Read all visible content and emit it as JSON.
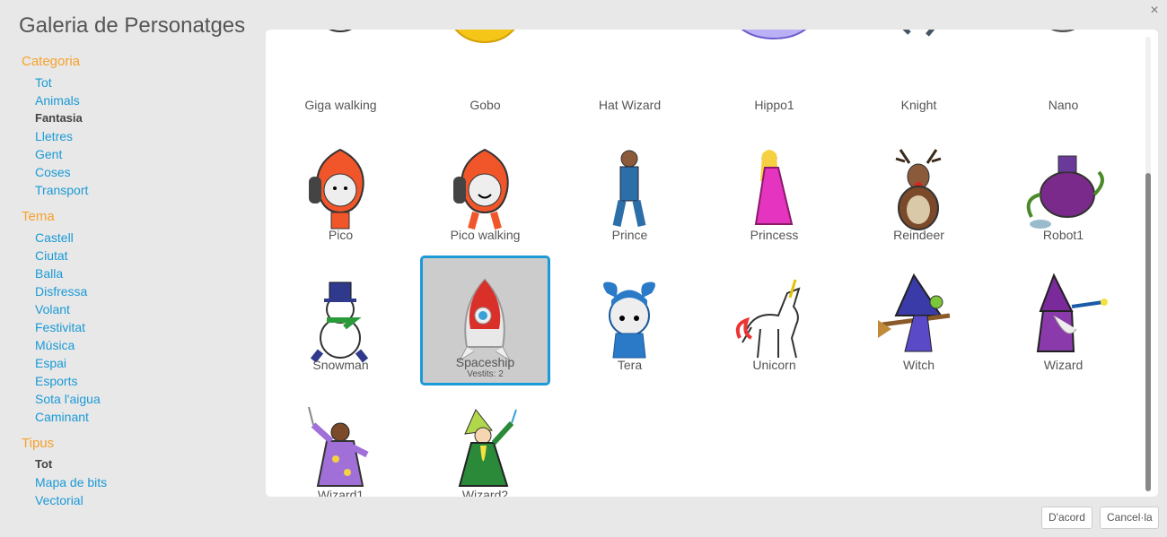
{
  "title": "Galeria de Personatges",
  "close_glyph": "×",
  "sidebar": {
    "groups": [
      {
        "heading": "Categoria",
        "items": [
          {
            "label": "Tot",
            "selected": false
          },
          {
            "label": "Animals",
            "selected": false
          },
          {
            "label": "Fantasia",
            "selected": true
          },
          {
            "label": "Lletres",
            "selected": false
          },
          {
            "label": "Gent",
            "selected": false
          },
          {
            "label": "Coses",
            "selected": false
          },
          {
            "label": "Transport",
            "selected": false
          }
        ]
      },
      {
        "heading": "Tema",
        "items": [
          {
            "label": "Castell",
            "selected": false
          },
          {
            "label": "Ciutat",
            "selected": false
          },
          {
            "label": "Balla",
            "selected": false
          },
          {
            "label": "Disfressa",
            "selected": false
          },
          {
            "label": "Volant",
            "selected": false
          },
          {
            "label": "Festivitat",
            "selected": false
          },
          {
            "label": "Música",
            "selected": false
          },
          {
            "label": "Espai",
            "selected": false
          },
          {
            "label": "Esports",
            "selected": false
          },
          {
            "label": "Sota l'aigua",
            "selected": false
          },
          {
            "label": "Caminant",
            "selected": false
          }
        ]
      },
      {
        "heading": "Tipus",
        "items": [
          {
            "label": "Tot",
            "selected": true
          },
          {
            "label": "Mapa de bits",
            "selected": false
          },
          {
            "label": "Vectorial",
            "selected": false
          }
        ]
      }
    ]
  },
  "sprites": [
    {
      "name": "Giga walking",
      "icon": "giga-walking-icon"
    },
    {
      "name": "Gobo",
      "icon": "gobo-icon"
    },
    {
      "name": "Hat Wizard",
      "icon": "hat-wizard-icon"
    },
    {
      "name": "Hippo1",
      "icon": "hippo-icon"
    },
    {
      "name": "Knight",
      "icon": "knight-icon"
    },
    {
      "name": "Nano",
      "icon": "nano-icon"
    },
    {
      "name": "Pico",
      "icon": "pico-icon"
    },
    {
      "name": "Pico walking",
      "icon": "pico-walking-icon"
    },
    {
      "name": "Prince",
      "icon": "prince-icon"
    },
    {
      "name": "Princess",
      "icon": "princess-icon"
    },
    {
      "name": "Reindeer",
      "icon": "reindeer-icon"
    },
    {
      "name": "Robot1",
      "icon": "robot-icon"
    },
    {
      "name": "Snowman",
      "icon": "snowman-icon"
    },
    {
      "name": "Spaceship",
      "icon": "spaceship-icon",
      "selected": true,
      "sub": "Vestits: 2"
    },
    {
      "name": "Tera",
      "icon": "tera-icon"
    },
    {
      "name": "Unicorn",
      "icon": "unicorn-icon"
    },
    {
      "name": "Witch",
      "icon": "witch-icon"
    },
    {
      "name": "Wizard",
      "icon": "wizard-icon"
    },
    {
      "name": "Wizard1",
      "icon": "wizard1-icon"
    },
    {
      "name": "Wizard2",
      "icon": "wizard2-icon"
    }
  ],
  "buttons": {
    "ok": "D'acord",
    "cancel": "Cancel·la"
  },
  "colors": {
    "accent": "#1a9ad6",
    "heading": "#f7a12a"
  }
}
